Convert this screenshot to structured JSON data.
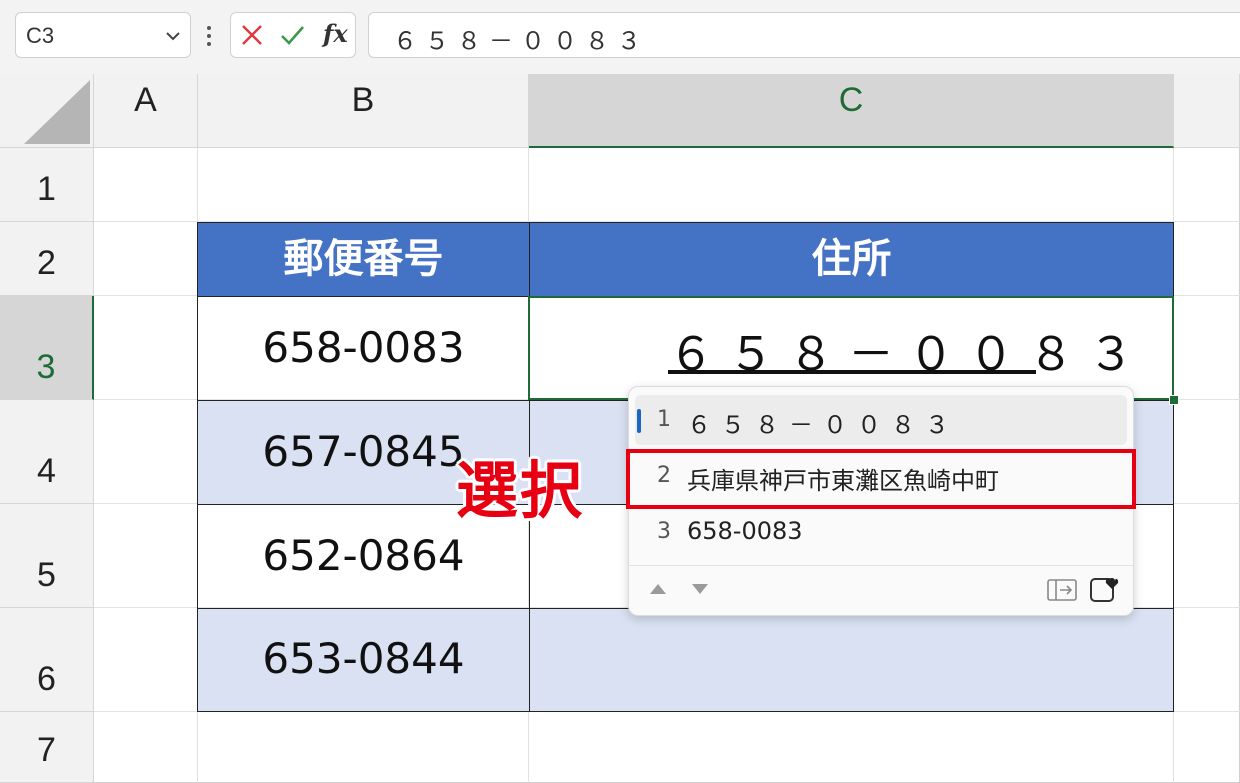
{
  "name_box": {
    "value": "C3"
  },
  "formula_bar": {
    "fx": "fx",
    "content": "６５８－００８３"
  },
  "columns": [
    "A",
    "B",
    "C"
  ],
  "rows": [
    "1",
    "2",
    "3",
    "4",
    "5",
    "6",
    "7"
  ],
  "table": {
    "headers": [
      "郵便番号",
      "住所"
    ],
    "postal_codes": [
      "658-0083",
      "657-0845",
      "652-0864",
      "653-0844"
    ]
  },
  "active_cell": {
    "ime_input": "６５８－００８３"
  },
  "ime_candidates": [
    {
      "index": "1",
      "text": "６５８－００８３"
    },
    {
      "index": "2",
      "text": "兵庫県神戸市東灘区魚崎中町"
    },
    {
      "index": "3",
      "text": "658-0083"
    }
  ],
  "annotation": {
    "label": "選択",
    "color": "#e60012"
  },
  "colors": {
    "header_blue": "#4472c4",
    "band": "#d9e1f2",
    "selection_green": "#1e6b35"
  }
}
